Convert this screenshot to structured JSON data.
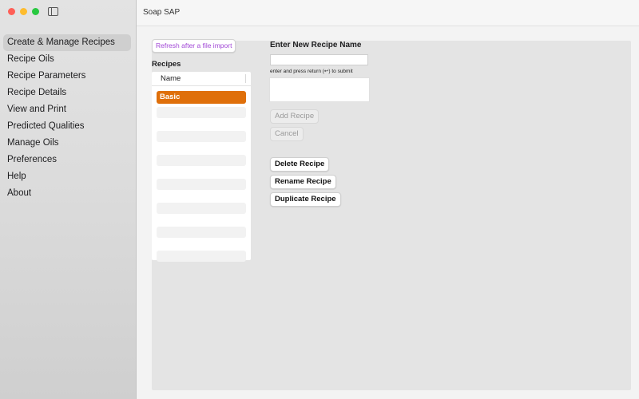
{
  "window": {
    "title": "Soap SAP"
  },
  "sidebar": {
    "items": [
      {
        "label": "Create & Manage Recipes",
        "active": true
      },
      {
        "label": "Recipe Oils"
      },
      {
        "label": "Recipe Parameters"
      },
      {
        "label": "Recipe Details"
      },
      {
        "label": "View and Print"
      },
      {
        "label": "Predicted Qualities"
      },
      {
        "label": "Manage Oils"
      },
      {
        "label": "Preferences"
      },
      {
        "label": "Help"
      },
      {
        "label": "About"
      }
    ]
  },
  "main": {
    "refresh_label": "Refresh after a file import",
    "recipes_label": "Recipes",
    "table": {
      "column": "Name",
      "rows": [
        "Basic"
      ]
    },
    "new_recipe": {
      "title": "Enter New Recipe Name",
      "input_value": "",
      "hint": "enter and press return (↩) to submit"
    },
    "buttons": {
      "add": "Add Recipe",
      "cancel": "Cancel",
      "delete": "Delete Recipe",
      "rename": "Rename Recipe",
      "duplicate": "Duplicate Recipe"
    }
  },
  "colors": {
    "accent": "#df6f0a",
    "link": "#a147d6"
  }
}
